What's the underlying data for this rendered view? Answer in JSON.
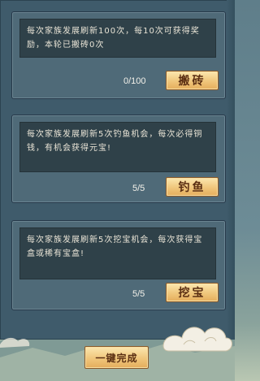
{
  "tasks": [
    {
      "description": "每次家族发展刷新100次，每10次可获得奖励，本轮已搬砖0次",
      "progress": "0/100",
      "button_label": "搬砖"
    },
    {
      "description": "每次家族发展刷新5次钓鱼机会，每次必得铜钱，有机会获得元宝!",
      "progress": "5/5",
      "button_label": "钓鱼"
    },
    {
      "description": "每次家族发展刷新5次挖宝机会，每次获得宝盒或稀有宝盒!",
      "progress": "5/5",
      "button_label": "挖宝"
    }
  ],
  "footer": {
    "complete_all_label": "一键完成"
  },
  "colors": {
    "panel": "#3f5b6b",
    "card": "#4f6a78",
    "text_box": "#2f4149",
    "button_gold": "#f0c67b",
    "button_text": "#5a2e12"
  }
}
